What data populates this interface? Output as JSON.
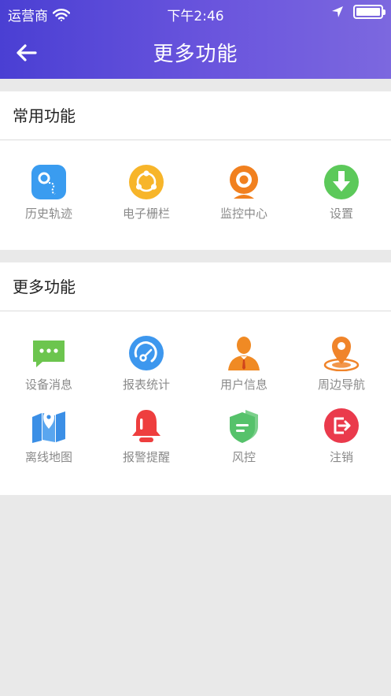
{
  "status_bar": {
    "carrier": "运营商",
    "time": "下午2:46"
  },
  "nav": {
    "title": "更多功能"
  },
  "common": {
    "title": "常用功能",
    "items": [
      {
        "label": "历史轨迹",
        "icon": "history-track-icon",
        "color": "#3a9cf0"
      },
      {
        "label": "电子栅栏",
        "icon": "geofence-icon",
        "color": "#f7b52a"
      },
      {
        "label": "监控中心",
        "icon": "monitor-camera-icon",
        "color": "#f1801f"
      },
      {
        "label": "设置",
        "icon": "download-settings-icon",
        "color": "#5cc95a"
      }
    ]
  },
  "more": {
    "title": "更多功能",
    "items": [
      {
        "label": "设备消息",
        "icon": "message-icon",
        "color": "#6cc54e"
      },
      {
        "label": "报表统计",
        "icon": "report-chart-icon",
        "color": "#3d97ee"
      },
      {
        "label": "用户信息",
        "icon": "user-icon",
        "color": "#f08a24"
      },
      {
        "label": "周边导航",
        "icon": "location-pin-icon",
        "color": "#f0842a"
      },
      {
        "label": "离线地图",
        "icon": "map-icon",
        "color": "#3b8fe6"
      },
      {
        "label": "报警提醒",
        "icon": "alarm-bell-icon",
        "color": "#ee3e3e"
      },
      {
        "label": "风控",
        "icon": "shield-icon",
        "color": "#56c26b"
      },
      {
        "label": "注销",
        "icon": "logout-icon",
        "color": "#ea3a4c"
      }
    ]
  }
}
